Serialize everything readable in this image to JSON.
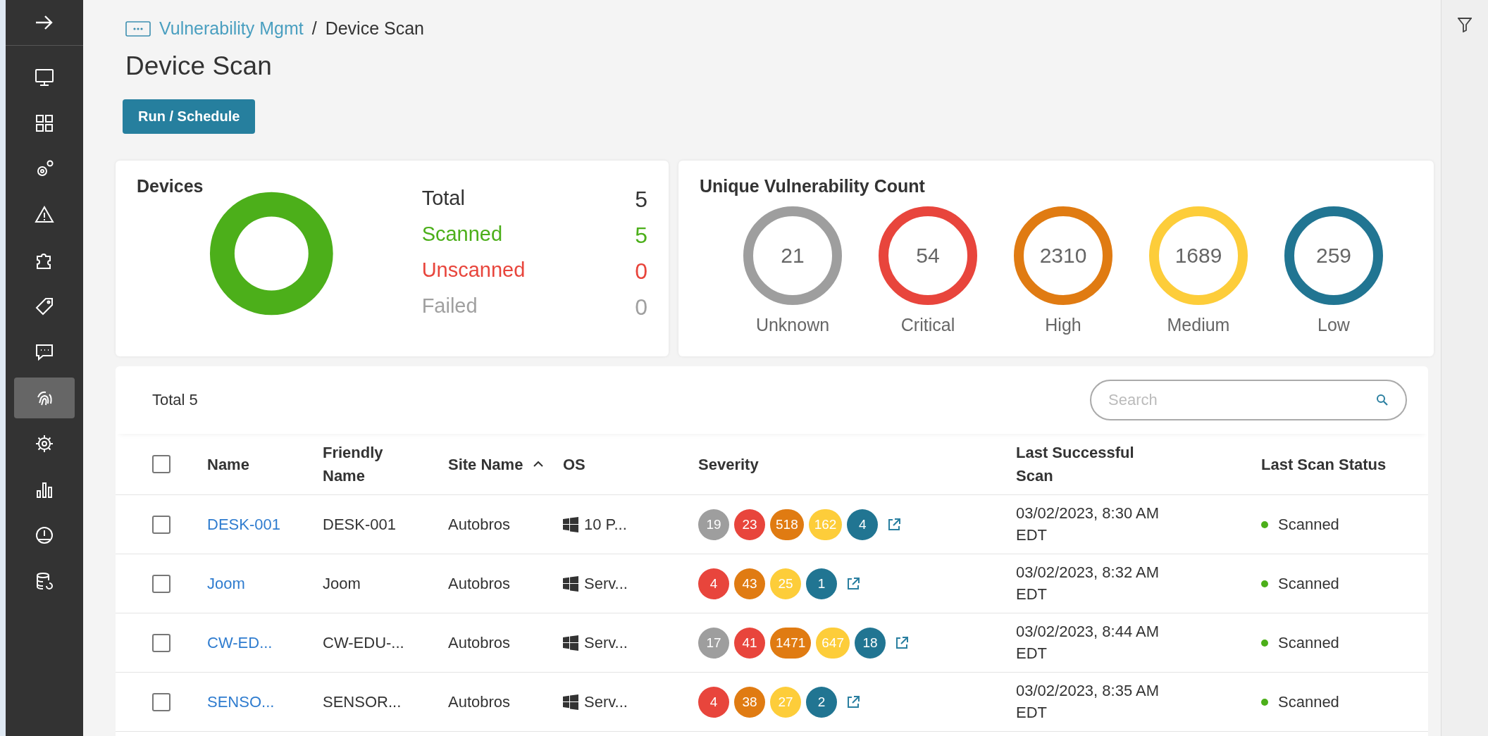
{
  "sidebar": {
    "items": [
      {
        "selected": false
      },
      {
        "selected": false
      },
      {
        "selected": false
      },
      {
        "selected": false
      },
      {
        "selected": false
      },
      {
        "selected": false
      },
      {
        "selected": false
      },
      {
        "selected": true
      },
      {
        "selected": false
      },
      {
        "selected": false
      },
      {
        "selected": false
      },
      {
        "selected": false
      }
    ]
  },
  "breadcrumb": {
    "parent": "Vulnerability Mgmt",
    "separator": "/",
    "current": "Device Scan"
  },
  "title": "Device Scan",
  "run_button": "Run / Schedule",
  "devices": {
    "title": "Devices",
    "stats": [
      {
        "label": "Total",
        "value": "5",
        "color": "#333333",
        "kind": "total"
      },
      {
        "label": "Scanned",
        "value": "5",
        "color": "#4caf1a",
        "kind": "segment"
      },
      {
        "label": "Unscanned",
        "value": "0",
        "color": "#e8453c",
        "kind": "segment"
      },
      {
        "label": "Failed",
        "value": "0",
        "color": "#a0a0a0",
        "kind": "segment"
      }
    ]
  },
  "vulnerabilities": {
    "title": "Unique Vulnerability Count",
    "items": [
      {
        "count": "21",
        "label": "Unknown",
        "color": "#9e9e9e"
      },
      {
        "count": "54",
        "label": "Critical",
        "color": "#e8453c"
      },
      {
        "count": "2310",
        "label": "High",
        "color": "#e07b12"
      },
      {
        "count": "1689",
        "label": "Medium",
        "color": "#fdcd3a"
      },
      {
        "count": "259",
        "label": "Low",
        "color": "#217592"
      }
    ]
  },
  "table": {
    "total": "Total 5",
    "search": {
      "placeholder": "Search"
    },
    "select_all": {
      "checked": false
    },
    "columns": [
      {
        "label": "Name",
        "sorted": false
      },
      {
        "label": "Friendly Name",
        "sorted": false
      },
      {
        "label": "Site Name",
        "sorted": true
      },
      {
        "label": "OS",
        "sorted": false
      },
      {
        "label": "Severity",
        "sorted": false
      },
      {
        "label": "Last Successful Scan",
        "sorted": false
      },
      {
        "label": "Last Scan Status",
        "sorted": false
      }
    ],
    "rows": [
      {
        "checked": false,
        "name": "DESK-001",
        "friendly": "DESK-001",
        "site": "Autobros",
        "os": "10 P...",
        "severity": [
          {
            "count": "19",
            "color": "#9e9e9e"
          },
          {
            "count": "23",
            "color": "#e8453c"
          },
          {
            "count": "518",
            "color": "#e07b12"
          },
          {
            "count": "162",
            "color": "#fdcd3a"
          },
          {
            "count": "4",
            "color": "#217592"
          }
        ],
        "last_scan": "03/02/2023, 8:30 AM EDT",
        "status": {
          "text": "Scanned",
          "color": "#4caf1a"
        }
      },
      {
        "checked": false,
        "name": "Joom",
        "friendly": "Joom",
        "site": "Autobros",
        "os": "Serv...",
        "severity": [
          {
            "count": "4",
            "color": "#e8453c"
          },
          {
            "count": "43",
            "color": "#e07b12"
          },
          {
            "count": "25",
            "color": "#fdcd3a"
          },
          {
            "count": "1",
            "color": "#217592"
          }
        ],
        "last_scan": "03/02/2023, 8:32 AM EDT",
        "status": {
          "text": "Scanned",
          "color": "#4caf1a"
        }
      },
      {
        "checked": false,
        "name": "CW-ED...",
        "friendly": "CW-EDU-...",
        "site": "Autobros",
        "os": "Serv...",
        "severity": [
          {
            "count": "17",
            "color": "#9e9e9e"
          },
          {
            "count": "41",
            "color": "#e8453c"
          },
          {
            "count": "1471",
            "color": "#e07b12"
          },
          {
            "count": "647",
            "color": "#fdcd3a"
          },
          {
            "count": "18",
            "color": "#217592"
          }
        ],
        "last_scan": "03/02/2023, 8:44 AM EDT",
        "status": {
          "text": "Scanned",
          "color": "#4caf1a"
        }
      },
      {
        "checked": false,
        "name": "SENSO...",
        "friendly": "SENSOR...",
        "site": "Autobros",
        "os": "Serv...",
        "severity": [
          {
            "count": "4",
            "color": "#e8453c"
          },
          {
            "count": "38",
            "color": "#e07b12"
          },
          {
            "count": "27",
            "color": "#fdcd3a"
          },
          {
            "count": "2",
            "color": "#217592"
          }
        ],
        "last_scan": "03/02/2023, 8:35 AM EDT",
        "status": {
          "text": "Scanned",
          "color": "#4caf1a"
        }
      }
    ]
  }
}
